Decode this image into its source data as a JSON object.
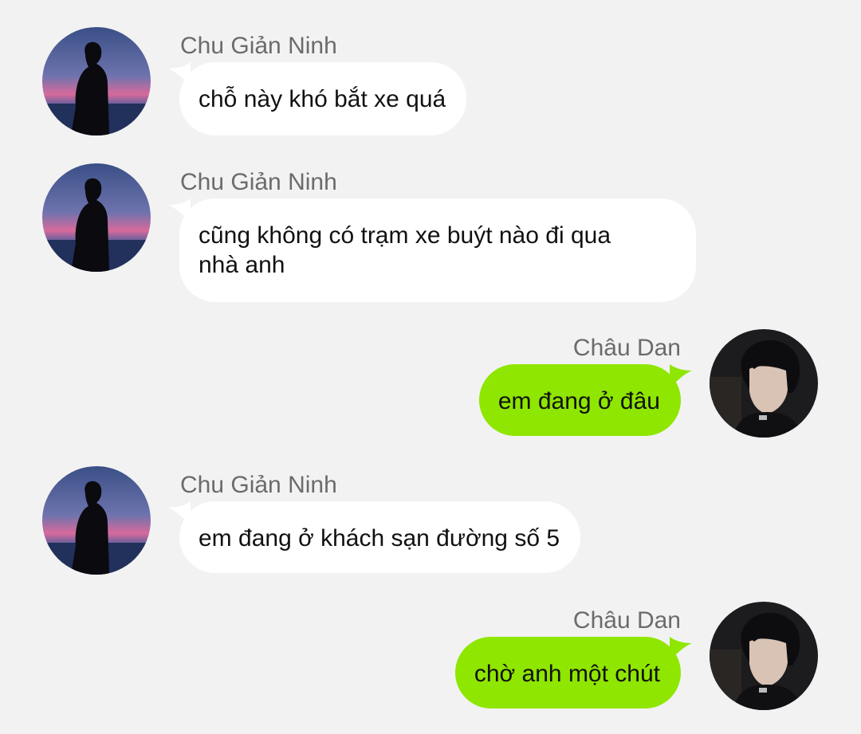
{
  "chat": {
    "messages": [
      {
        "sender": "Chu Giản Ninh",
        "side": "left",
        "text": "chỗ này khó bắt xe quá"
      },
      {
        "sender": "Chu Giản Ninh",
        "side": "left",
        "text": "cũng không có trạm xe buýt nào đi qua\nnhà anh"
      },
      {
        "sender": "Châu Dan",
        "side": "right",
        "text": "em đang ở đâu"
      },
      {
        "sender": "Chu Giản Ninh",
        "side": "left",
        "text": "em đang ở khách sạn đường số 5"
      },
      {
        "sender": "Châu Dan",
        "side": "right",
        "text": "chờ anh một chút"
      }
    ]
  },
  "colors": {
    "background": "#f2f2f2",
    "incoming_bubble": "#ffffff",
    "outgoing_bubble": "#8fe600",
    "sender_name": "#6b6b6b"
  },
  "icons": {
    "left_avatar": "silhouette-at-sunset-avatar",
    "right_avatar": "dark-haired-portrait-avatar"
  }
}
